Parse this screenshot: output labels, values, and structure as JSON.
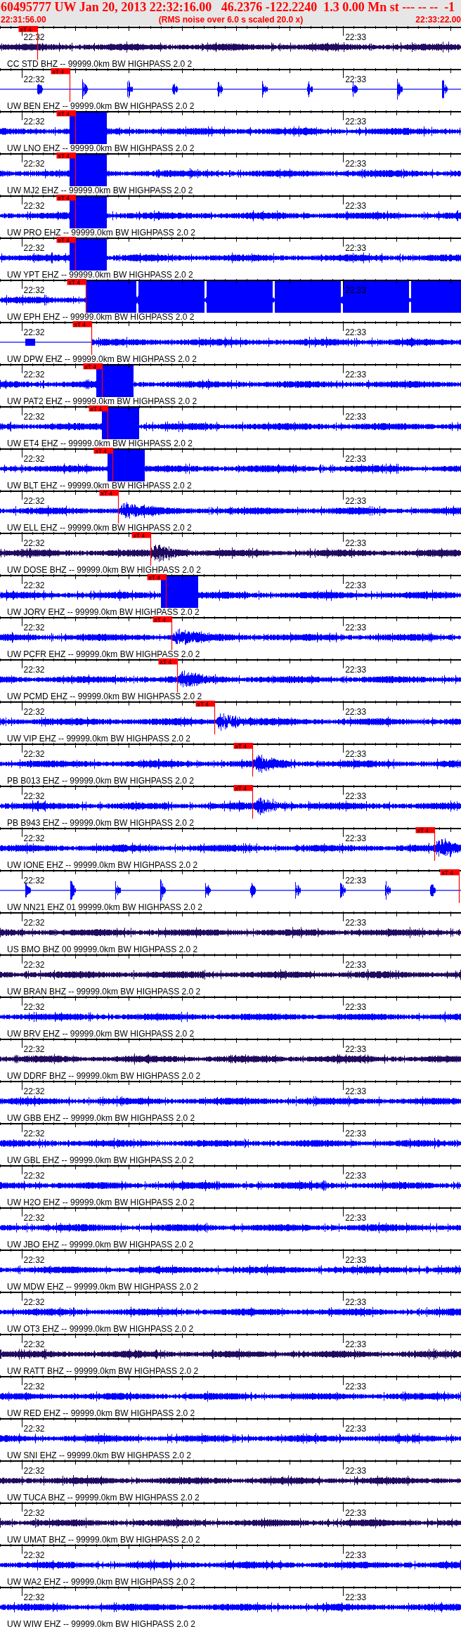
{
  "header": {
    "title": "60495777 UW Jan 20, 2013 22:32:16.00   46.2376 -122.2240  1.3 0.00 Mn st --- -- --  -1",
    "start": "22:31:56.00",
    "note": "(RMS noise over 6.0 s scaled 20.0 x)",
    "end": "22:33:22.00"
  },
  "traces": [
    {
      "color": "#200a60",
      "kind": "noise",
      "ticks": [
        "22:32",
        "22:33"
      ],
      "pick": {
        "label": "xT 4",
        "level": 0.081
      }
    },
    {
      "label": "CC STD BHZ -- 99999.0km BW HIGHPASS 2.0 2",
      "color": "#0000ff",
      "kind": "spikes",
      "ticks": [
        "22:32",
        "22:33"
      ],
      "pick": {
        "label": "xT 4",
        "level": 0.151
      }
    },
    {
      "label": "UW BEN EHZ -- 99999.0km BW HIGHPASS 2.0 2",
      "color": "#0000ff",
      "kind": "clipped",
      "ticks": [
        "22:32",
        "22:33"
      ],
      "pick": {
        "label": "xT 4",
        "level": 0.163
      }
    },
    {
      "label": "UW LNO EHZ -- 99999.0km BW HIGHPASS 2.0 2",
      "color": "#0000ff",
      "kind": "clipped",
      "ticks": [
        "22:32",
        "22:33"
      ],
      "pick": {
        "label": "xT 4",
        "level": 0.163
      }
    },
    {
      "label": "UW MJ2 EHZ -- 99999.0km BW HIGHPASS 2.0 2",
      "color": "#0000ff",
      "kind": "clipped",
      "ticks": [
        "22:32",
        "22:33"
      ],
      "pick": {
        "label": "xT 4",
        "level": 0.163
      }
    },
    {
      "label": "UW PRO EHZ -- 99999.0km BW HIGHPASS 2.0 2",
      "color": "#0000ff",
      "kind": "clipped",
      "ticks": [
        "22:32",
        "22:33"
      ],
      "pick": {
        "label": "xT 4",
        "level": 0.163
      }
    },
    {
      "label": "UW YPT EHZ -- 99999.0km BW HIGHPASS 2.0 2",
      "color": "#0000ff",
      "kind": "saturated",
      "ticks": [
        "22:32",
        "22:33"
      ],
      "pick": {
        "label": "xT 4",
        "level": 0.186
      }
    },
    {
      "label": "UW EPH EHZ -- 99999.0km BW HIGHPASS 2.0 2",
      "color": "#0000ff",
      "kind": "onset",
      "ticks": [
        "22:32",
        "22:33"
      ],
      "pick": {
        "label": "xT 4",
        "level": 0.198
      }
    },
    {
      "label": "UW DPW EHZ -- 99999.0km BW HIGHPASS 2.0 2",
      "color": "#0000ff",
      "kind": "clipped",
      "ticks": [
        "22:32",
        "22:33"
      ],
      "pick": {
        "label": "xT 4",
        "level": 0.221
      }
    },
    {
      "label": "UW PAT2 EHZ -- 99999.0km BW HIGHPASS 2.0 2",
      "color": "#0000ff",
      "kind": "clipped",
      "ticks": [
        "22:32",
        "22:33"
      ],
      "pick": {
        "label": "xT 4",
        "level": 0.233
      }
    },
    {
      "label": "UW ET4 EHZ -- 99999.0km BW HIGHPASS 2.0 2",
      "color": "#0000ff",
      "kind": "clipped",
      "ticks": [
        "22:32",
        "22:33"
      ],
      "pick": {
        "label": "xT 4",
        "level": 0.244
      }
    },
    {
      "label": "UW BLT EHZ -- 99999.0km BW HIGHPASS 2.0 2",
      "color": "#0000ff",
      "kind": "quake",
      "ticks": [
        "22:32",
        "22:33"
      ],
      "pick": {
        "label": "xT 4",
        "level": 0.256
      }
    },
    {
      "label": "UW ELL EHZ -- 99999.0km BW HIGHPASS 2.0 2",
      "color": "#200a60",
      "kind": "quake",
      "ticks": [
        "22:32",
        "22:33"
      ],
      "pick": {
        "label": "xT 4",
        "level": 0.326
      }
    },
    {
      "label": "UW DOSE BHZ -- 99999.0km BW HIGHPASS 2.0 2",
      "color": "#0000ff",
      "kind": "clipped",
      "ticks": [
        "22:32",
        "22:33"
      ],
      "pick": {
        "label": "xT 4",
        "level": 0.36
      }
    },
    {
      "label": "UW JORV EHZ -- 99999.0km BW HIGHPASS 2.0 2",
      "color": "#0000ff",
      "kind": "quake",
      "ticks": [
        "22:32",
        "22:33"
      ],
      "pick": {
        "label": "xT 4",
        "level": 0.372
      }
    },
    {
      "label": "UW PCFR EHZ -- 99999.0km BW HIGHPASS 2.0 2",
      "color": "#0000ff",
      "kind": "quake",
      "ticks": [
        "22:32",
        "22:33"
      ],
      "pick": {
        "label": "xT 4",
        "level": 0.384
      }
    },
    {
      "label": "UW PCMD EHZ -- 99999.0km BW HIGHPASS 2.0 2",
      "color": "#0000ff",
      "kind": "quake",
      "ticks": [
        "22:32",
        "22:33"
      ],
      "pick": {
        "label": "xT 4",
        "level": 0.465
      }
    },
    {
      "label": "UW VIP EHZ -- 99999.0km BW HIGHPASS 2.0 2",
      "color": "#0000ff",
      "kind": "quake",
      "ticks": [
        "22:32",
        "22:33"
      ],
      "pick": {
        "label": "xT 4",
        "level": 0.547
      }
    },
    {
      "label": "PB B013 EHZ -- 99999.0km BW HIGHPASS 2.0 2",
      "color": "#0000ff",
      "kind": "quake",
      "ticks": [
        "22:32",
        "22:33"
      ],
      "pick": {
        "label": "xT 4",
        "level": 0.547
      }
    },
    {
      "label": "PB B943 EHZ -- 99999.0km BW HIGHPASS 2.0 2",
      "color": "#0000ff",
      "kind": "quake",
      "ticks": [
        "22:32",
        "22:33"
      ],
      "pick": {
        "label": "xT 4",
        "level": 0.942
      }
    },
    {
      "label": "UW IONE EHZ -- 99999.0km BW HIGHPASS 2.0 2",
      "color": "#0000ff",
      "kind": "spikes",
      "ticks": [
        "22:32",
        "22:33"
      ],
      "pick": {
        "label": "xT 4",
        "level": 0.995
      }
    },
    {
      "label": "UW NN21 EHZ 01 99999.0km BW HIGHPASS 2.0 2",
      "color": "#200a60",
      "kind": "noise",
      "ticks": [
        "22:32",
        "22:33"
      ]
    },
    {
      "label": "US BMO BHZ 00 99999.0km BW HIGHPASS 2.0 2",
      "color": "#200a60",
      "kind": "noise",
      "ticks": [
        "22:32",
        "22:33"
      ]
    },
    {
      "label": "UW BRAN BHZ -- 99999.0km BW HIGHPASS 2.0 2",
      "color": "#0000ff",
      "kind": "noise",
      "ticks": [
        "22:32",
        "22:33"
      ]
    },
    {
      "label": "UW BRV EHZ -- 99999.0km BW HIGHPASS 2.0 2",
      "color": "#200a60",
      "kind": "noise",
      "ticks": [
        "22:32",
        "22:33"
      ]
    },
    {
      "label": "UW DDRF BHZ -- 99999.0km BW HIGHPASS 2.0 2",
      "color": "#0000ff",
      "kind": "noise",
      "ticks": [
        "22:32",
        "22:33"
      ]
    },
    {
      "label": "UW GBB EHZ -- 99999.0km BW HIGHPASS 2.0 2",
      "color": "#0000ff",
      "kind": "noise",
      "ticks": [
        "22:32",
        "22:33"
      ]
    },
    {
      "label": "UW GBL EHZ -- 99999.0km BW HIGHPASS 2.0 2",
      "color": "#0000ff",
      "kind": "noise",
      "ticks": [
        "22:32",
        "22:33"
      ]
    },
    {
      "label": "UW H2O EHZ -- 99999.0km BW HIGHPASS 2.0 2",
      "color": "#0000ff",
      "kind": "noise",
      "ticks": [
        "22:32",
        "22:33"
      ]
    },
    {
      "label": "UW JBO EHZ -- 99999.0km BW HIGHPASS 2.0 2",
      "color": "#0000ff",
      "kind": "noise",
      "ticks": [
        "22:32",
        "22:33"
      ]
    },
    {
      "label": "UW MDW EHZ -- 99999.0km BW HIGHPASS 2.0 2",
      "color": "#0000ff",
      "kind": "noise",
      "ticks": [
        "22:32",
        "22:33"
      ]
    },
    {
      "label": "UW OT3 EHZ -- 99999.0km BW HIGHPASS 2.0 2",
      "color": "#200a60",
      "kind": "noise",
      "ticks": [
        "22:32",
        "22:33"
      ]
    },
    {
      "label": "UW RATT BHZ -- 99999.0km BW HIGHPASS 2.0 2",
      "color": "#0000ff",
      "kind": "noise",
      "ticks": [
        "22:32",
        "22:33"
      ]
    },
    {
      "label": "UW RED EHZ -- 99999.0km BW HIGHPASS 2.0 2",
      "color": "#0000ff",
      "kind": "noise",
      "ticks": [
        "22:32",
        "22:33"
      ]
    },
    {
      "label": "UW SNI EHZ -- 99999.0km BW HIGHPASS 2.0 2",
      "color": "#200a60",
      "kind": "noise",
      "ticks": [
        "22:32",
        "22:33"
      ]
    },
    {
      "label": "UW TUCA BHZ -- 99999.0km BW HIGHPASS 2.0 2",
      "color": "#200a60",
      "kind": "noise",
      "ticks": [
        "22:32",
        "22:33"
      ]
    },
    {
      "label": "UW UMAT BHZ -- 99999.0km BW HIGHPASS 2.0 2",
      "color": "#0000ff",
      "kind": "noise",
      "ticks": [
        "22:32",
        "22:33"
      ]
    },
    {
      "label": "UW WA2 EHZ -- 99999.0km BW HIGHPASS 2.0 2",
      "color": "#0000ff",
      "kind": "noise",
      "ticks": [
        "22:32",
        "22:33"
      ]
    },
    {
      "label": "UW WIW EHZ -- 99999.0km BW HIGHPASS 2.0 2"
    }
  ]
}
